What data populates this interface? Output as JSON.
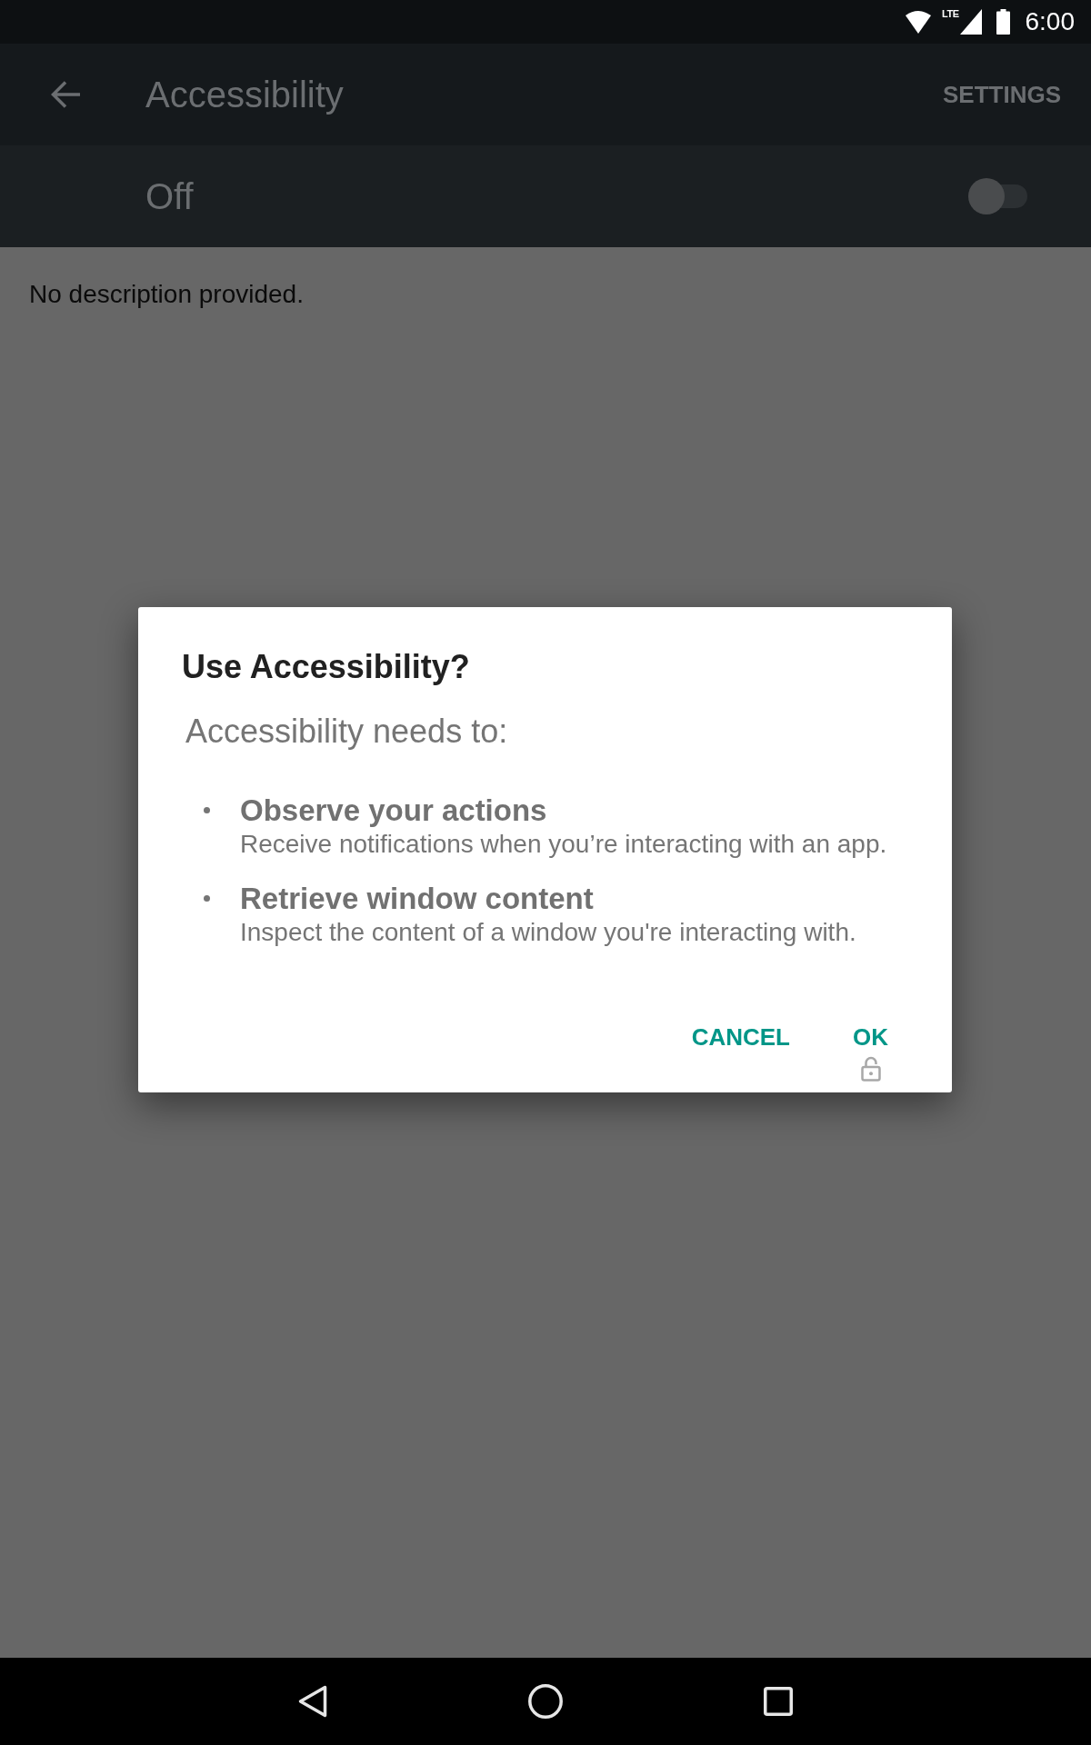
{
  "status_bar": {
    "network_type": "LTE",
    "time": "6:00"
  },
  "app_bar": {
    "title": "Accessibility",
    "action": "SETTINGS"
  },
  "master_switch": {
    "label": "Off",
    "on": false
  },
  "description": "No description provided.",
  "dialog": {
    "title": "Use Accessibility?",
    "intro": "Accessibility needs to:",
    "capabilities": [
      {
        "title": "Observe your actions",
        "detail": "Receive notifications when you’re interacting with an app."
      },
      {
        "title": "Retrieve window content",
        "detail": "Inspect the content of a window you're interacting with."
      }
    ],
    "buttons": [
      {
        "label": "CANCEL",
        "locked": false
      },
      {
        "label": "OK",
        "locked": true
      }
    ]
  }
}
